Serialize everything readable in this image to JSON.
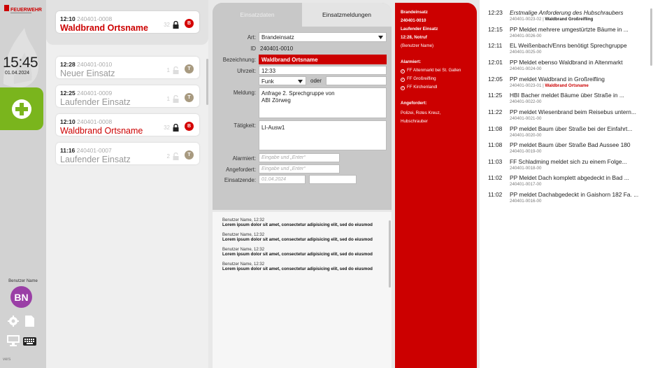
{
  "sidebar": {
    "logo_text": "FEUERWEHR",
    "clock": "15:45",
    "date": "01.04.2024",
    "user_name": "Benutzer Name",
    "avatar_initials": "BN",
    "version": "vers"
  },
  "incidents": [
    {
      "time": "12:10",
      "number": "240401-0008",
      "title": "Waldbrand Ortsname",
      "count": "32",
      "badge": "B",
      "badge_color": "#d40000",
      "locked": true,
      "red": true,
      "bold": true
    },
    {
      "time": "12:28",
      "number": "240401-0010",
      "title": "Neuer Einsatz",
      "count": "1",
      "badge": "T",
      "badge_color": "#a89a80",
      "locked": false,
      "red": false,
      "bold": false
    },
    {
      "time": "12:25",
      "number": "240401-0009",
      "title": "Laufender Einsatz",
      "count": "1",
      "badge": "T",
      "badge_color": "#a89a80",
      "locked": false,
      "red": false,
      "bold": false
    },
    {
      "time": "12:10",
      "number": "240401-0008",
      "title": "Waldbrand Ortsname",
      "count": "32",
      "badge": "B",
      "badge_color": "#d40000",
      "locked": true,
      "red": true,
      "bold": false
    },
    {
      "time": "11:16",
      "number": "240401-0007",
      "title": "Laufender Einsatz",
      "count": "2",
      "badge": "T",
      "badge_color": "#a89a80",
      "locked": false,
      "red": false,
      "bold": false
    }
  ],
  "form": {
    "tab_einsatzdaten": "Einsatzdaten",
    "tab_einsatzmeldungen": "Einsatzmeldungen",
    "label_art": "Art:",
    "art_value": "Brandeinsatz",
    "label_id": "ID",
    "id_value": "240401-0010",
    "label_bezeichnung": "Bezeichnung:",
    "bezeichnung_value": "Waldbrand Ortsname",
    "label_uhrzeit": "Uhrzeit:",
    "uhrzeit_value": "12:33",
    "funk_value": "Funk",
    "oder_label": "oder",
    "label_meldung": "Meldung:",
    "meldung_value": "Anfrage 2. Sprechgruppe von\nABI Zörweg",
    "label_taetigkeit": "Tätigkeit:",
    "taetigkeit_value": "LI-Ausw1",
    "label_alarmiert": "Alarmiert:",
    "alarmiert_placeholder": "Eingabe und „Enter“",
    "label_angefordert": "Angefordert:",
    "angefordert_placeholder": "Eingabe und „Enter“",
    "label_einsatzende": "Einsatzende:",
    "einsatzende_placeholder": "01.04.2024"
  },
  "log": [
    {
      "who": "Benutzer Name, 12:32",
      "msg": "Lorem ipsum dolor sit amet, consectetur adipisicing elit, sed do eiusmod"
    },
    {
      "who": "Benutzer Name, 12:32",
      "msg": "Lorem ipsum dolor sit amet, consectetur adipisicing elit, sed do eiusmod"
    },
    {
      "who": "Benutzer Name, 12:32",
      "msg": "Lorem ipsum dolor sit amet, consectetur adipisicing elit, sed do eiusmod"
    },
    {
      "who": "Benutzer Name, 12:32",
      "msg": "Lorem ipsum dolor sit amet, consectetur adipisicing elit, sed do eiusmod"
    }
  ],
  "summary": {
    "type": "Brandeinsatz",
    "id": "240401-0010",
    "title": "Laufender Einsatz",
    "time_notruf": "12:28, Notruf",
    "user": "(Benutzer Name)",
    "alarmiert_label": "Alarmiert:",
    "alarmiert": [
      "FF Altenmarkt bei St. Gallen",
      "FF Großreifling",
      "FF Kirchenlandl"
    ],
    "angefordert_label": "Angefordert:",
    "angefordert": "Polizei, Rotes Kreuz,\nHubschrauber"
  },
  "messages": [
    {
      "time": "12:23",
      "text": "Erstmalige Anforderung des Hubschraubers",
      "id": "240401-0023-02",
      "tag": "Waldbrand Großreifling",
      "tag_red": false,
      "italic": true
    },
    {
      "time": "12:15",
      "text": "PP Meldet mehrere umgestürtzte Bäume in ...",
      "id": "240401-0026-00",
      "tag": "",
      "tag_red": false,
      "italic": false
    },
    {
      "time": "12:11",
      "text": "EL Weißenbach/Enns benötigt Sprechgruppe",
      "id": "240401-0025-00",
      "tag": "",
      "tag_red": false,
      "italic": false
    },
    {
      "time": "12:01",
      "text": "PP Meldet ebenso Waldbrand in Altenmarkt",
      "id": "240401-0024-00",
      "tag": "",
      "tag_red": false,
      "italic": false
    },
    {
      "time": "12:05",
      "text": "PP meldet Waldbrand in Großreifling",
      "id": "240401-0023-01",
      "tag": "Waldbrand Ortsname",
      "tag_red": true,
      "italic": false
    },
    {
      "time": "11:25",
      "text": "HBI Bacher meldet Bäume über Straße in ...",
      "id": "240401-0022-00",
      "tag": "",
      "tag_red": false,
      "italic": false
    },
    {
      "time": "11:22",
      "text": "PP meldet Wiesenbrand beim Reisebus untern...",
      "id": "240401-0021-00",
      "tag": "",
      "tag_red": false,
      "italic": false
    },
    {
      "time": "11:08",
      "text": "PP meldet Baum über Straße bei der Einfahrt...",
      "id": "240401-0020-00",
      "tag": "",
      "tag_red": false,
      "italic": false
    },
    {
      "time": "11:08",
      "text": "PP  meldet Baum über Straße Bad Aussee 180",
      "id": "240401-0019-00",
      "tag": "",
      "tag_red": false,
      "italic": false
    },
    {
      "time": "11:03",
      "text": "FF Schladming meldet sich zu einem Folge...",
      "id": "240401-0018-00",
      "tag": "",
      "tag_red": false,
      "italic": false
    },
    {
      "time": "11:02",
      "text": "PP Meldet Dach komplett abgedeckt in Bad ...",
      "id": "240401-0017-00",
      "tag": "",
      "tag_red": false,
      "italic": false
    },
    {
      "time": "11:02",
      "text": "PP meldet Dachabgedeckt in Gaishorn 182 Fa. ...",
      "id": "240401-0016-00",
      "tag": "",
      "tag_red": false,
      "italic": false
    }
  ],
  "colors": {
    "accent_red": "#cc0000",
    "accent_green": "#7ab51d",
    "avatar_purple": "#9a3fa6"
  }
}
